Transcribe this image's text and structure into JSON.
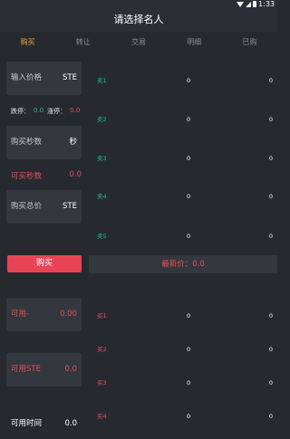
{
  "status_bar": {
    "time": "1:33"
  },
  "title": "请选择名人",
  "tabs": [
    {
      "label": "购买",
      "active": true
    },
    {
      "label": "转让",
      "active": false
    },
    {
      "label": "交易",
      "active": false
    },
    {
      "label": "明细",
      "active": false
    },
    {
      "label": "已购",
      "active": false
    }
  ],
  "form": {
    "price_label": "输入价格",
    "price_unit": "STE",
    "limit_up_label": "跌停：",
    "limit_up_value": "0.0",
    "limit_down_label": "涨停：",
    "limit_down_value": "0.0",
    "seconds_label": "购买秒数",
    "seconds_unit": "秒",
    "available_seconds_label": "可买秒数",
    "available_seconds_value": "0.0",
    "total_label": "购买总价",
    "total_unit": "STE",
    "buy_button": "购买",
    "available_label": "可用-",
    "available_value": "0.00",
    "available_ste_label": "可用STE",
    "available_ste_value": "0.0",
    "available_time_label": "可用时间",
    "available_time_value": "0.0"
  },
  "order_book": {
    "sell": [
      {
        "label": "卖1",
        "price": "0",
        "amount": "0"
      },
      {
        "label": "卖2",
        "price": "0",
        "amount": "0"
      },
      {
        "label": "卖3",
        "price": "0",
        "amount": "0"
      },
      {
        "label": "卖4",
        "price": "0",
        "amount": "0"
      },
      {
        "label": "卖5",
        "price": "0",
        "amount": "0"
      }
    ],
    "latest_price": "最新价：0.0",
    "buy": [
      {
        "label": "买1",
        "price": "0",
        "amount": "0"
      },
      {
        "label": "买2",
        "price": "0",
        "amount": "0"
      },
      {
        "label": "买3",
        "price": "0",
        "amount": "0"
      },
      {
        "label": "买4",
        "price": "0",
        "amount": "0"
      }
    ]
  },
  "colors": {
    "active_tab": "#f0a43a",
    "sell": "#17c08a",
    "buy": "#e5505c",
    "button": "#e84456"
  }
}
